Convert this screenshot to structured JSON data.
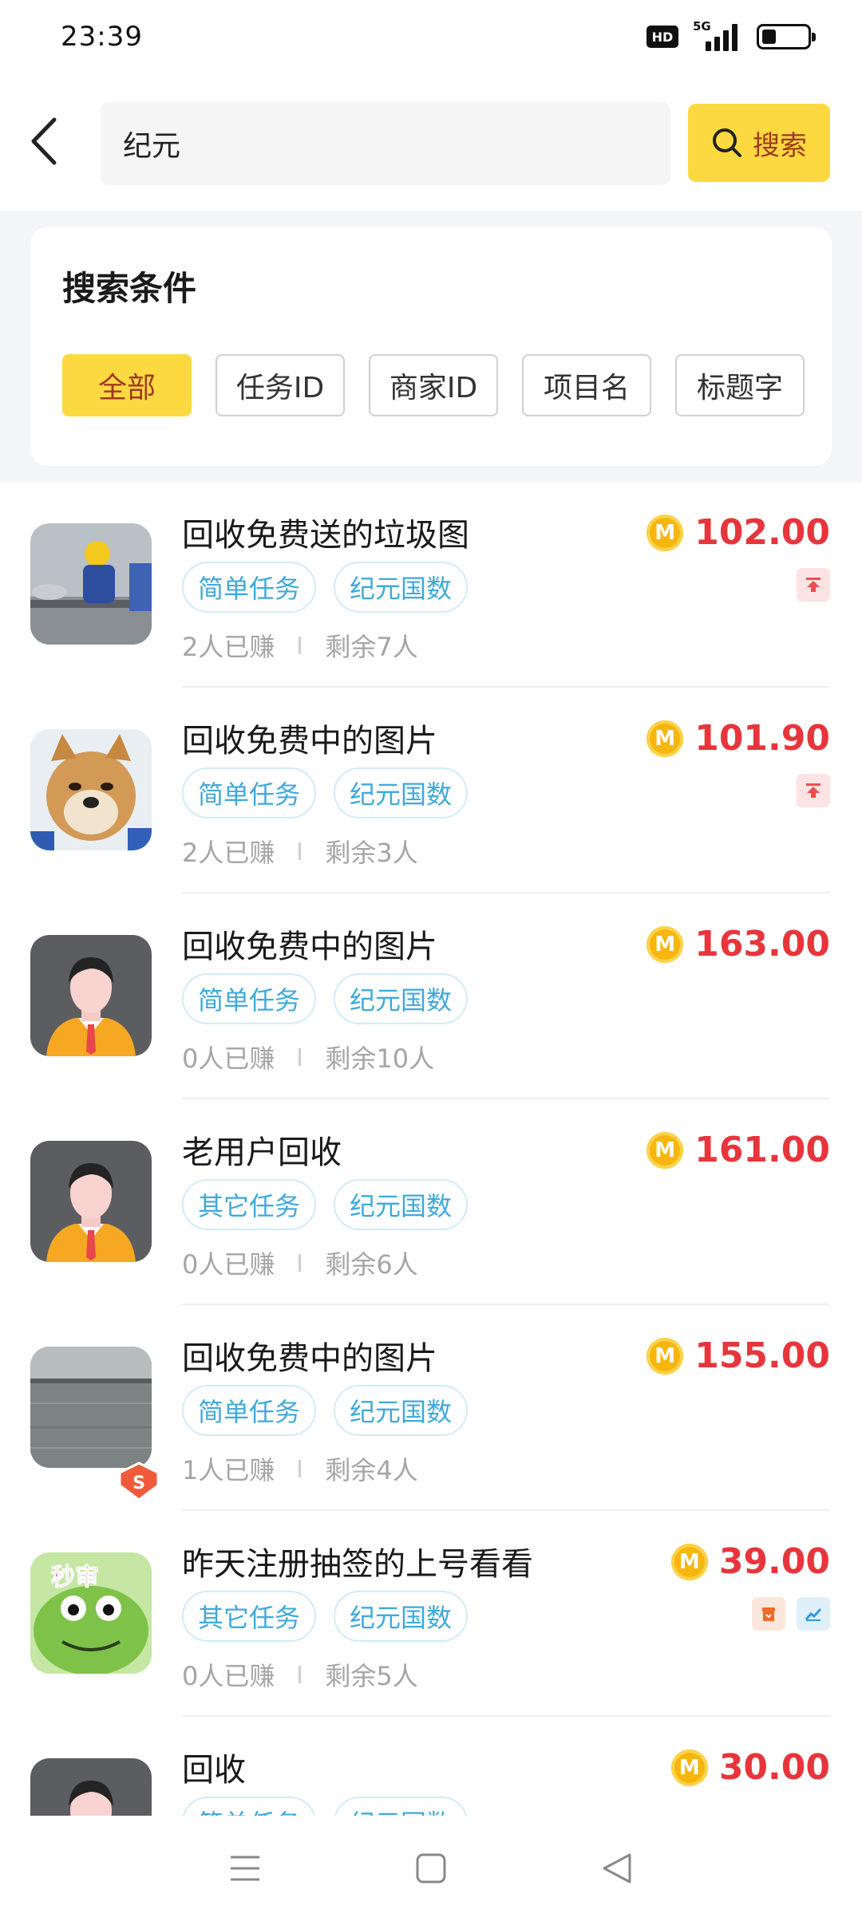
{
  "status_bar": {
    "time": "23:39",
    "network": "5G"
  },
  "search": {
    "value": "纪元",
    "button_label": "搜索"
  },
  "filter": {
    "title": "搜索条件",
    "chips": [
      {
        "label": "全部",
        "active": true
      },
      {
        "label": "任务ID",
        "active": false
      },
      {
        "label": "商家ID",
        "active": false
      },
      {
        "label": "项目名",
        "active": false
      },
      {
        "label": "标题字",
        "active": false
      }
    ]
  },
  "coin_letter": "M",
  "tasks": [
    {
      "title": "回收免费送的垃圾图",
      "tags": [
        "简单任务",
        "纪元国数"
      ],
      "earned": "2人已赚",
      "remaining": "剩余7人",
      "amount": "102.00",
      "icons": [
        "pin-icon"
      ],
      "thumb": "photo-worker"
    },
    {
      "title": "回收免费中的图片",
      "tags": [
        "简单任务",
        "纪元国数"
      ],
      "earned": "2人已赚",
      "remaining": "剩余3人",
      "amount": "101.90",
      "icons": [
        "pin-icon"
      ],
      "thumb": "photo-dog"
    },
    {
      "title": "回收免费中的图片",
      "tags": [
        "简单任务",
        "纪元国数"
      ],
      "earned": "0人已赚",
      "remaining": "剩余10人",
      "amount": "163.00",
      "icons": [],
      "thumb": "default-avatar"
    },
    {
      "title": "老用户回收",
      "tags": [
        "其它任务",
        "纪元国数"
      ],
      "earned": "0人已赚",
      "remaining": "剩余6人",
      "amount": "161.00",
      "icons": [],
      "thumb": "default-avatar"
    },
    {
      "title": "回收免费中的图片",
      "tags": [
        "简单任务",
        "纪元国数"
      ],
      "earned": "1人已赚",
      "remaining": "剩余4人",
      "amount": "155.00",
      "icons": [],
      "thumb": "photo-water"
    },
    {
      "title": "昨天注册抽签的上号看看",
      "tags": [
        "其它任务",
        "纪元国数"
      ],
      "earned": "0人已赚",
      "remaining": "剩余5人",
      "amount": "39.00",
      "icons": [
        "gift-icon",
        "trend-icon"
      ],
      "thumb": "photo-frog",
      "thumb_text": "秒审"
    },
    {
      "title": "回收",
      "tags": [
        "简单任务",
        "纪元国数"
      ],
      "earned": "",
      "remaining": "",
      "amount": "30.00",
      "icons": [],
      "thumb": "default-avatar"
    }
  ]
}
